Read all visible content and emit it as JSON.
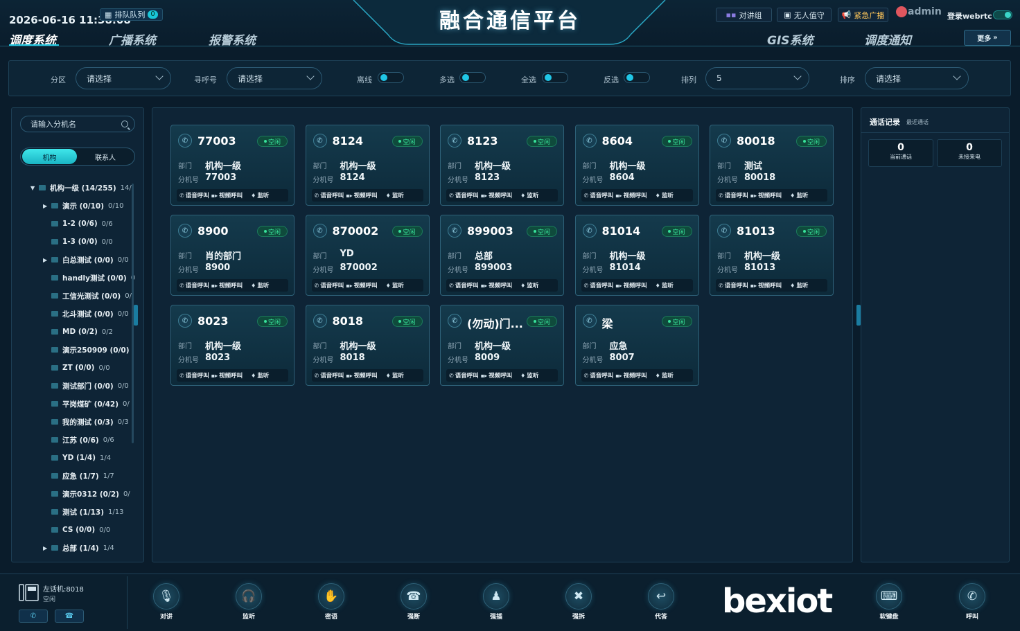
{
  "header": {
    "datetime": "2026-06-16 11:38:08",
    "queue_label": "排队队列",
    "queue_count": "0",
    "title": "融合通信平台",
    "nav_left": [
      "调度系统",
      "广播系统",
      "报警系统"
    ],
    "nav_right": [
      "GIS系统",
      "调度通知"
    ],
    "buttons": {
      "intercom_group": "对讲组",
      "unattended": "无人值守",
      "emergency_broadcast": "紧急广播"
    },
    "user": "admin",
    "webrtc_label": "登录webrtc",
    "more_label": "更多"
  },
  "filters": {
    "partition_label": "分区",
    "partition_value": "请选择",
    "paging_label": "寻呼号",
    "paging_value": "请选择",
    "offline_label": "离线",
    "multi_label": "多选",
    "all_label": "全选",
    "invert_label": "反选",
    "columns_label": "排列",
    "columns_value": "5",
    "sort_label": "排序",
    "sort_value": "请选择"
  },
  "sidebar": {
    "search_placeholder": "请输入分机名",
    "tabs": [
      "机构",
      "联系人"
    ],
    "tree": [
      {
        "label": "机构一级 (14/255)",
        "count": "14/",
        "arrow": "▼",
        "level": 0
      },
      {
        "label": "演示 (0/10)",
        "count": "0/10",
        "arrow": "▶",
        "level": 1
      },
      {
        "label": "1-2 (0/6)",
        "count": "0/6",
        "arrow": "",
        "level": 1
      },
      {
        "label": "1-3 (0/0)",
        "count": "0/0",
        "arrow": "",
        "level": 1
      },
      {
        "label": "白总测试 (0/0)",
        "count": "0/0",
        "arrow": "▶",
        "level": 1
      },
      {
        "label": "handly测试 (0/0)",
        "count": "0",
        "arrow": "",
        "level": 1
      },
      {
        "label": "工信光测试 (0/0)",
        "count": "0/",
        "arrow": "",
        "level": 1
      },
      {
        "label": "北斗测试 (0/0)",
        "count": "0/0",
        "arrow": "",
        "level": 1
      },
      {
        "label": "MD (0/2)",
        "count": "0/2",
        "arrow": "",
        "level": 1
      },
      {
        "label": "演示250909 (0/0)",
        "count": "",
        "arrow": "",
        "level": 1
      },
      {
        "label": "ZT (0/0)",
        "count": "0/0",
        "arrow": "",
        "level": 1
      },
      {
        "label": "测试部门 (0/0)",
        "count": "0/0",
        "arrow": "",
        "level": 1
      },
      {
        "label": "平岗煤矿 (0/42)",
        "count": "0/",
        "arrow": "",
        "level": 1
      },
      {
        "label": "我的测试 (0/3)",
        "count": "0/3",
        "arrow": "",
        "level": 1
      },
      {
        "label": "江苏 (0/6)",
        "count": "0/6",
        "arrow": "",
        "level": 1
      },
      {
        "label": "YD (1/4)",
        "count": "1/4",
        "arrow": "",
        "level": 1
      },
      {
        "label": "应急 (1/7)",
        "count": "1/7",
        "arrow": "",
        "level": 1
      },
      {
        "label": "演示0312 (0/2)",
        "count": "0/",
        "arrow": "",
        "level": 1
      },
      {
        "label": "测试 (1/13)",
        "count": "1/13",
        "arrow": "",
        "level": 1
      },
      {
        "label": "CS (0/0)",
        "count": "0/0",
        "arrow": "",
        "level": 1
      },
      {
        "label": "总部 (1/4)",
        "count": "1/4",
        "arrow": "▶",
        "level": 1
      }
    ]
  },
  "card_labels": {
    "dept": "部门",
    "ext": "分机号",
    "voice": "语音呼叫",
    "video": "视频呼叫",
    "monitor": "监听"
  },
  "cards": [
    {
      "name": "77003",
      "status": "空闲",
      "dept": "机构一级",
      "ext": "77003"
    },
    {
      "name": "8124",
      "status": "空闲",
      "dept": "机构一级",
      "ext": "8124"
    },
    {
      "name": "8123",
      "status": "空闲",
      "dept": "机构一级",
      "ext": "8123"
    },
    {
      "name": "8604",
      "status": "空闲",
      "dept": "机构一级",
      "ext": "8604"
    },
    {
      "name": "80018",
      "status": "空闲",
      "dept": "测试",
      "ext": "80018"
    },
    {
      "name": "8900",
      "status": "空闲",
      "dept": "肖的部门",
      "ext": "8900"
    },
    {
      "name": "870002",
      "status": "空闲",
      "dept": "YD",
      "ext": "870002"
    },
    {
      "name": "899003",
      "status": "空闲",
      "dept": "总部",
      "ext": "899003"
    },
    {
      "name": "81014",
      "status": "空闲",
      "dept": "机构一级",
      "ext": "81014"
    },
    {
      "name": "81013",
      "status": "空闲",
      "dept": "机构一级",
      "ext": "81013"
    },
    {
      "name": "8023",
      "status": "空闲",
      "dept": "机构一级",
      "ext": "8023"
    },
    {
      "name": "8018",
      "status": "空闲",
      "dept": "机构一级",
      "ext": "8018"
    },
    {
      "name": "(勿动)门...",
      "status": "空闲",
      "dept": "机构一级",
      "ext": "8009"
    },
    {
      "name": "梁",
      "status": "空闲",
      "dept": "应急",
      "ext": "8007"
    }
  ],
  "call_record": {
    "title": "通话记录",
    "subtitle": "最近通话",
    "current_value": "0",
    "current_label": "当前通话",
    "missed_value": "0",
    "missed_label": "未接来电"
  },
  "footer": {
    "ext_name": "左话机:8018",
    "ext_state": "空闲",
    "buttons": [
      {
        "label": "对讲",
        "icon": "intercom-icon",
        "glyph": "🎙"
      },
      {
        "label": "监听",
        "icon": "headset-icon",
        "glyph": "🎧"
      },
      {
        "label": "密语",
        "icon": "whisper-icon",
        "glyph": "✋"
      },
      {
        "label": "强断",
        "icon": "force-disconnect-icon",
        "glyph": "☎"
      },
      {
        "label": "强插",
        "icon": "force-insert-icon",
        "glyph": "♟"
      },
      {
        "label": "强拆",
        "icon": "force-remove-icon",
        "glyph": "✖"
      },
      {
        "label": "代答",
        "icon": "pickup-icon",
        "glyph": "↩"
      },
      {
        "label": "软键盘",
        "icon": "keyboard-icon",
        "glyph": "⌨"
      },
      {
        "label": "呼叫",
        "icon": "call-icon",
        "glyph": "✆"
      }
    ],
    "logo": "bexiot"
  }
}
